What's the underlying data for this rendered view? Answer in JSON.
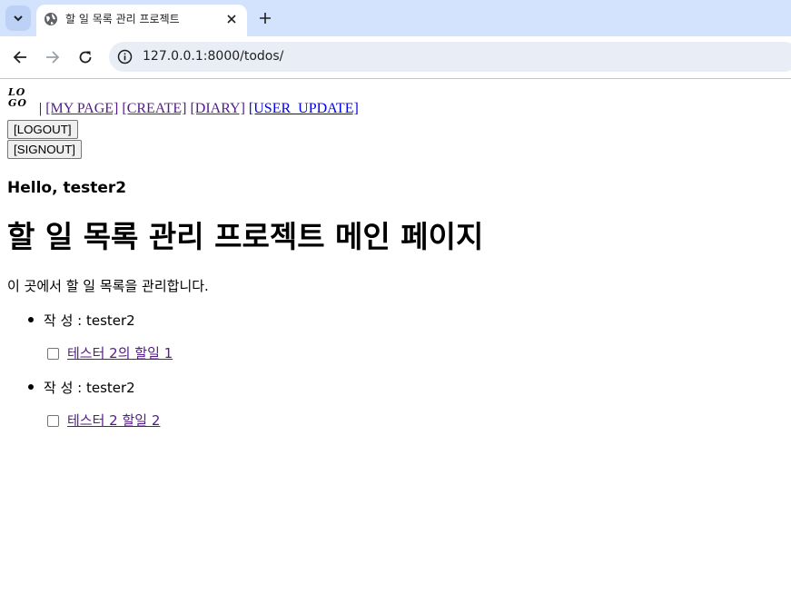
{
  "browser": {
    "tab_title": "할 일 목록 관리 프로젝트",
    "url": "127.0.0.1:8000/todos/"
  },
  "nav": {
    "logo_text_line1": "LO",
    "logo_text_line2": "GO",
    "separator": "|",
    "links": [
      "[MY PAGE]",
      "[CREATE]",
      "[DIARY]",
      "[USER_UPDATE]"
    ],
    "logout_label": "[LOGOUT]",
    "signout_label": "[SIGNOUT]"
  },
  "main": {
    "greeting": "Hello, tester2",
    "title": "할 일 목록 관리 프로젝트 메인 페이지",
    "description": "이 곳에서 할 일 목록을 관리합니다.",
    "todos": [
      {
        "author": "작 성 : tester2",
        "title": "테스터 2의 할일 1",
        "checked": false
      },
      {
        "author": "작 성 : tester2",
        "title": "테스터 2 할일 2",
        "checked": false
      }
    ]
  }
}
